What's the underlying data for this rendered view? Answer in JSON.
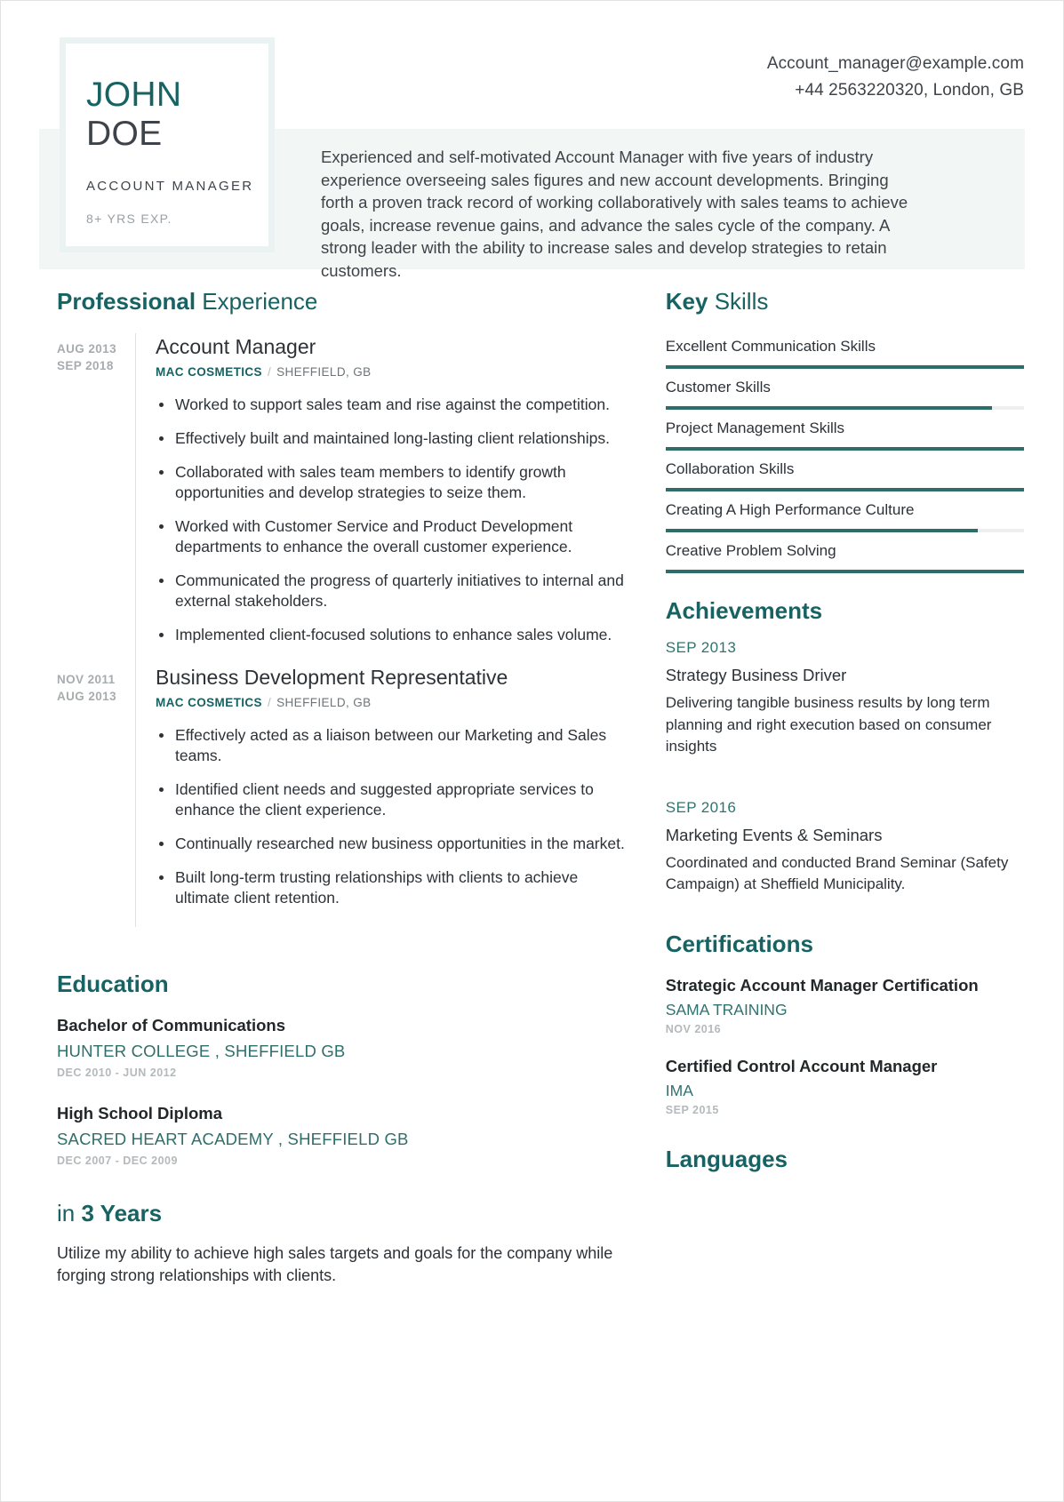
{
  "header": {
    "first_name": "JOHN",
    "last_name": "DOE",
    "role_title": "ACCOUNT MANAGER",
    "years_experience": "8+ YRS EXP.",
    "email": "Account_manager@example.com",
    "phone_location": "+44 2563220320, London, GB",
    "summary": "Experienced and self-motivated Account Manager with five years of industry experience overseeing sales figures and new account developments. Bringing forth a proven track record of working collaboratively with sales teams to achieve goals, increase revenue gains, and advance the sales cycle of the company. A strong leader with the ability to increase sales and develop strategies to retain customers."
  },
  "colors": {
    "accent_teal": "#176262",
    "accent_teal_light": "#2f7370",
    "band_bg": "#f2f7f5",
    "card_bg": "#eaf3f1",
    "body_text": "#2c3237",
    "muted_gray": "#b4b9bb",
    "rail_gray": "#dfe2e3",
    "track_gray": "#eceef0"
  },
  "experience": {
    "heading_bold": "Professional",
    "heading_rest": " Experience",
    "items": [
      {
        "date_start": "AUG 2013",
        "date_end": "SEP 2018",
        "title": "Account Manager",
        "company": "MAC COSMETICS",
        "separator": "/",
        "location": "SHEFFIELD, GB",
        "bullets": [
          "Worked to support sales team and rise against the competition.",
          "Effectively built and maintained long-lasting client relationships.",
          "Collaborated with sales team members to identify growth opportunities and develop strategies to seize them.",
          "Worked with Customer Service and Product Development departments to enhance the overall customer experience.",
          "Communicated the progress of quarterly initiatives to internal and external stakeholders.",
          "Implemented client-focused solutions to enhance sales volume."
        ]
      },
      {
        "date_start": "NOV 2011",
        "date_end": "AUG 2013",
        "title": "Business Development Representative",
        "company": "MAC COSMETICS",
        "separator": "/",
        "location": "SHEFFIELD, GB",
        "bullets": [
          "Effectively acted as a liaison between our Marketing and Sales teams.",
          "Identified client needs and suggested appropriate services to enhance the client experience.",
          "Continually researched new business opportunities in the market.",
          "Built long-term trusting relationships with clients to achieve ultimate client retention."
        ]
      }
    ]
  },
  "education": {
    "heading": "Education",
    "items": [
      {
        "degree": "Bachelor of Communications",
        "school": "HUNTER COLLEGE , SHEFFIELD GB",
        "dates": "DEC 2010 - JUN 2012"
      },
      {
        "degree": "High School Diploma",
        "school": "SACRED HEART ACADEMY , SHEFFIELD GB",
        "dates": "DEC 2007 - DEC 2009"
      }
    ]
  },
  "goal": {
    "heading_prefix": "in ",
    "heading_bold": "3 Years",
    "body": "Utilize my ability to achieve high sales targets and goals for the company while forging strong relationships with clients."
  },
  "key_skills": {
    "heading_bold": "Key",
    "heading_rest": " Skills",
    "items": [
      {
        "label": "Excellent Communication Skills",
        "level": 100
      },
      {
        "label": "Customer Skills",
        "level": 91
      },
      {
        "label": "Project Management Skills",
        "level": 100
      },
      {
        "label": "Collaboration Skills",
        "level": 100
      },
      {
        "label": "Creating A High Performance Culture",
        "level": 87
      },
      {
        "label": "Creative Problem Solving",
        "level": 100
      }
    ]
  },
  "achievements": {
    "heading": "Achievements",
    "items": [
      {
        "date": "SEP 2013",
        "title": "Strategy Business Driver",
        "description": "Delivering tangible business results by long term planning and right execution based on consumer insights"
      },
      {
        "date": "SEP 2016",
        "title": "Marketing Events & Seminars",
        "description": "Coordinated and conducted Brand Seminar (Safety Campaign) at Sheffield Municipality."
      }
    ]
  },
  "certifications": {
    "heading": "Certifications",
    "items": [
      {
        "name": "Strategic Account Manager Certification",
        "organization": "SAMA TRAINING",
        "date": "NOV 2016"
      },
      {
        "name": "Certified Control Account Manager",
        "organization": "IMA",
        "date": "SEP 2015"
      }
    ]
  },
  "languages": {
    "heading": "Languages"
  }
}
